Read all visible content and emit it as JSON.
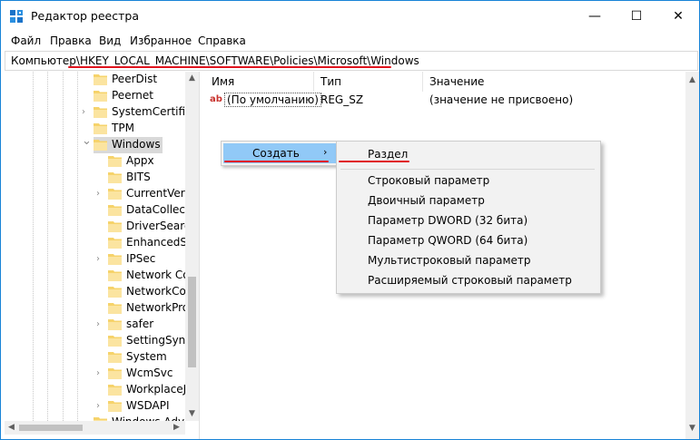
{
  "window": {
    "title": "Редактор реестра",
    "minimize": "—",
    "maximize": "☐",
    "close": "✕"
  },
  "menu": [
    "Файл",
    "Правка",
    "Вид",
    "Избранное",
    "Справка"
  ],
  "address": "Компьютер\\HKEY_LOCAL_MACHINE\\SOFTWARE\\Policies\\Microsoft\\Windows",
  "tree": [
    {
      "label": "PeerDist",
      "expandable": false
    },
    {
      "label": "Peernet",
      "expandable": false
    },
    {
      "label": "SystemCertific",
      "expandable": true
    },
    {
      "label": "TPM",
      "expandable": false
    },
    {
      "label": "Windows",
      "expandable": true,
      "expanded": true,
      "selected": true
    },
    {
      "label": "Appx",
      "expandable": false,
      "child": true
    },
    {
      "label": "BITS",
      "expandable": false,
      "child": true
    },
    {
      "label": "CurrentVers",
      "expandable": true,
      "child": true
    },
    {
      "label": "DataCollect",
      "expandable": false,
      "child": true
    },
    {
      "label": "DriverSearc",
      "expandable": false,
      "child": true
    },
    {
      "label": "EnhancedS",
      "expandable": false,
      "child": true
    },
    {
      "label": "IPSec",
      "expandable": true,
      "child": true
    },
    {
      "label": "Network Co",
      "expandable": false,
      "child": true
    },
    {
      "label": "NetworkCo",
      "expandable": false,
      "child": true
    },
    {
      "label": "NetworkPro",
      "expandable": false,
      "child": true
    },
    {
      "label": "safer",
      "expandable": true,
      "child": true
    },
    {
      "label": "SettingSync",
      "expandable": false,
      "child": true
    },
    {
      "label": "System",
      "expandable": false,
      "child": true
    },
    {
      "label": "WcmSvc",
      "expandable": true,
      "child": true
    },
    {
      "label": "WorkplaceJ",
      "expandable": false,
      "child": true
    },
    {
      "label": "WSDAPI",
      "expandable": true,
      "child": true
    },
    {
      "label": "Windows Adv",
      "expandable": false
    }
  ],
  "columns": {
    "name": "Имя",
    "type": "Тип",
    "value": "Значение"
  },
  "rows": [
    {
      "icon": "ab",
      "name": "(По умолчанию)",
      "type": "REG_SZ",
      "value": "(значение не присвоено)"
    }
  ],
  "context_menu": {
    "create": "Создать",
    "chevron": "›"
  },
  "submenu": {
    "section": "Раздел",
    "items": [
      "Строковый параметр",
      "Двоичный параметр",
      "Параметр DWORD (32 бита)",
      "Параметр QWORD (64 бита)",
      "Мультистроковый параметр",
      "Расширяемый строковый параметр"
    ]
  },
  "colors": {
    "highlight": "#91c9f7",
    "annotation": "#e0141e",
    "folder": "#f6d36b"
  }
}
